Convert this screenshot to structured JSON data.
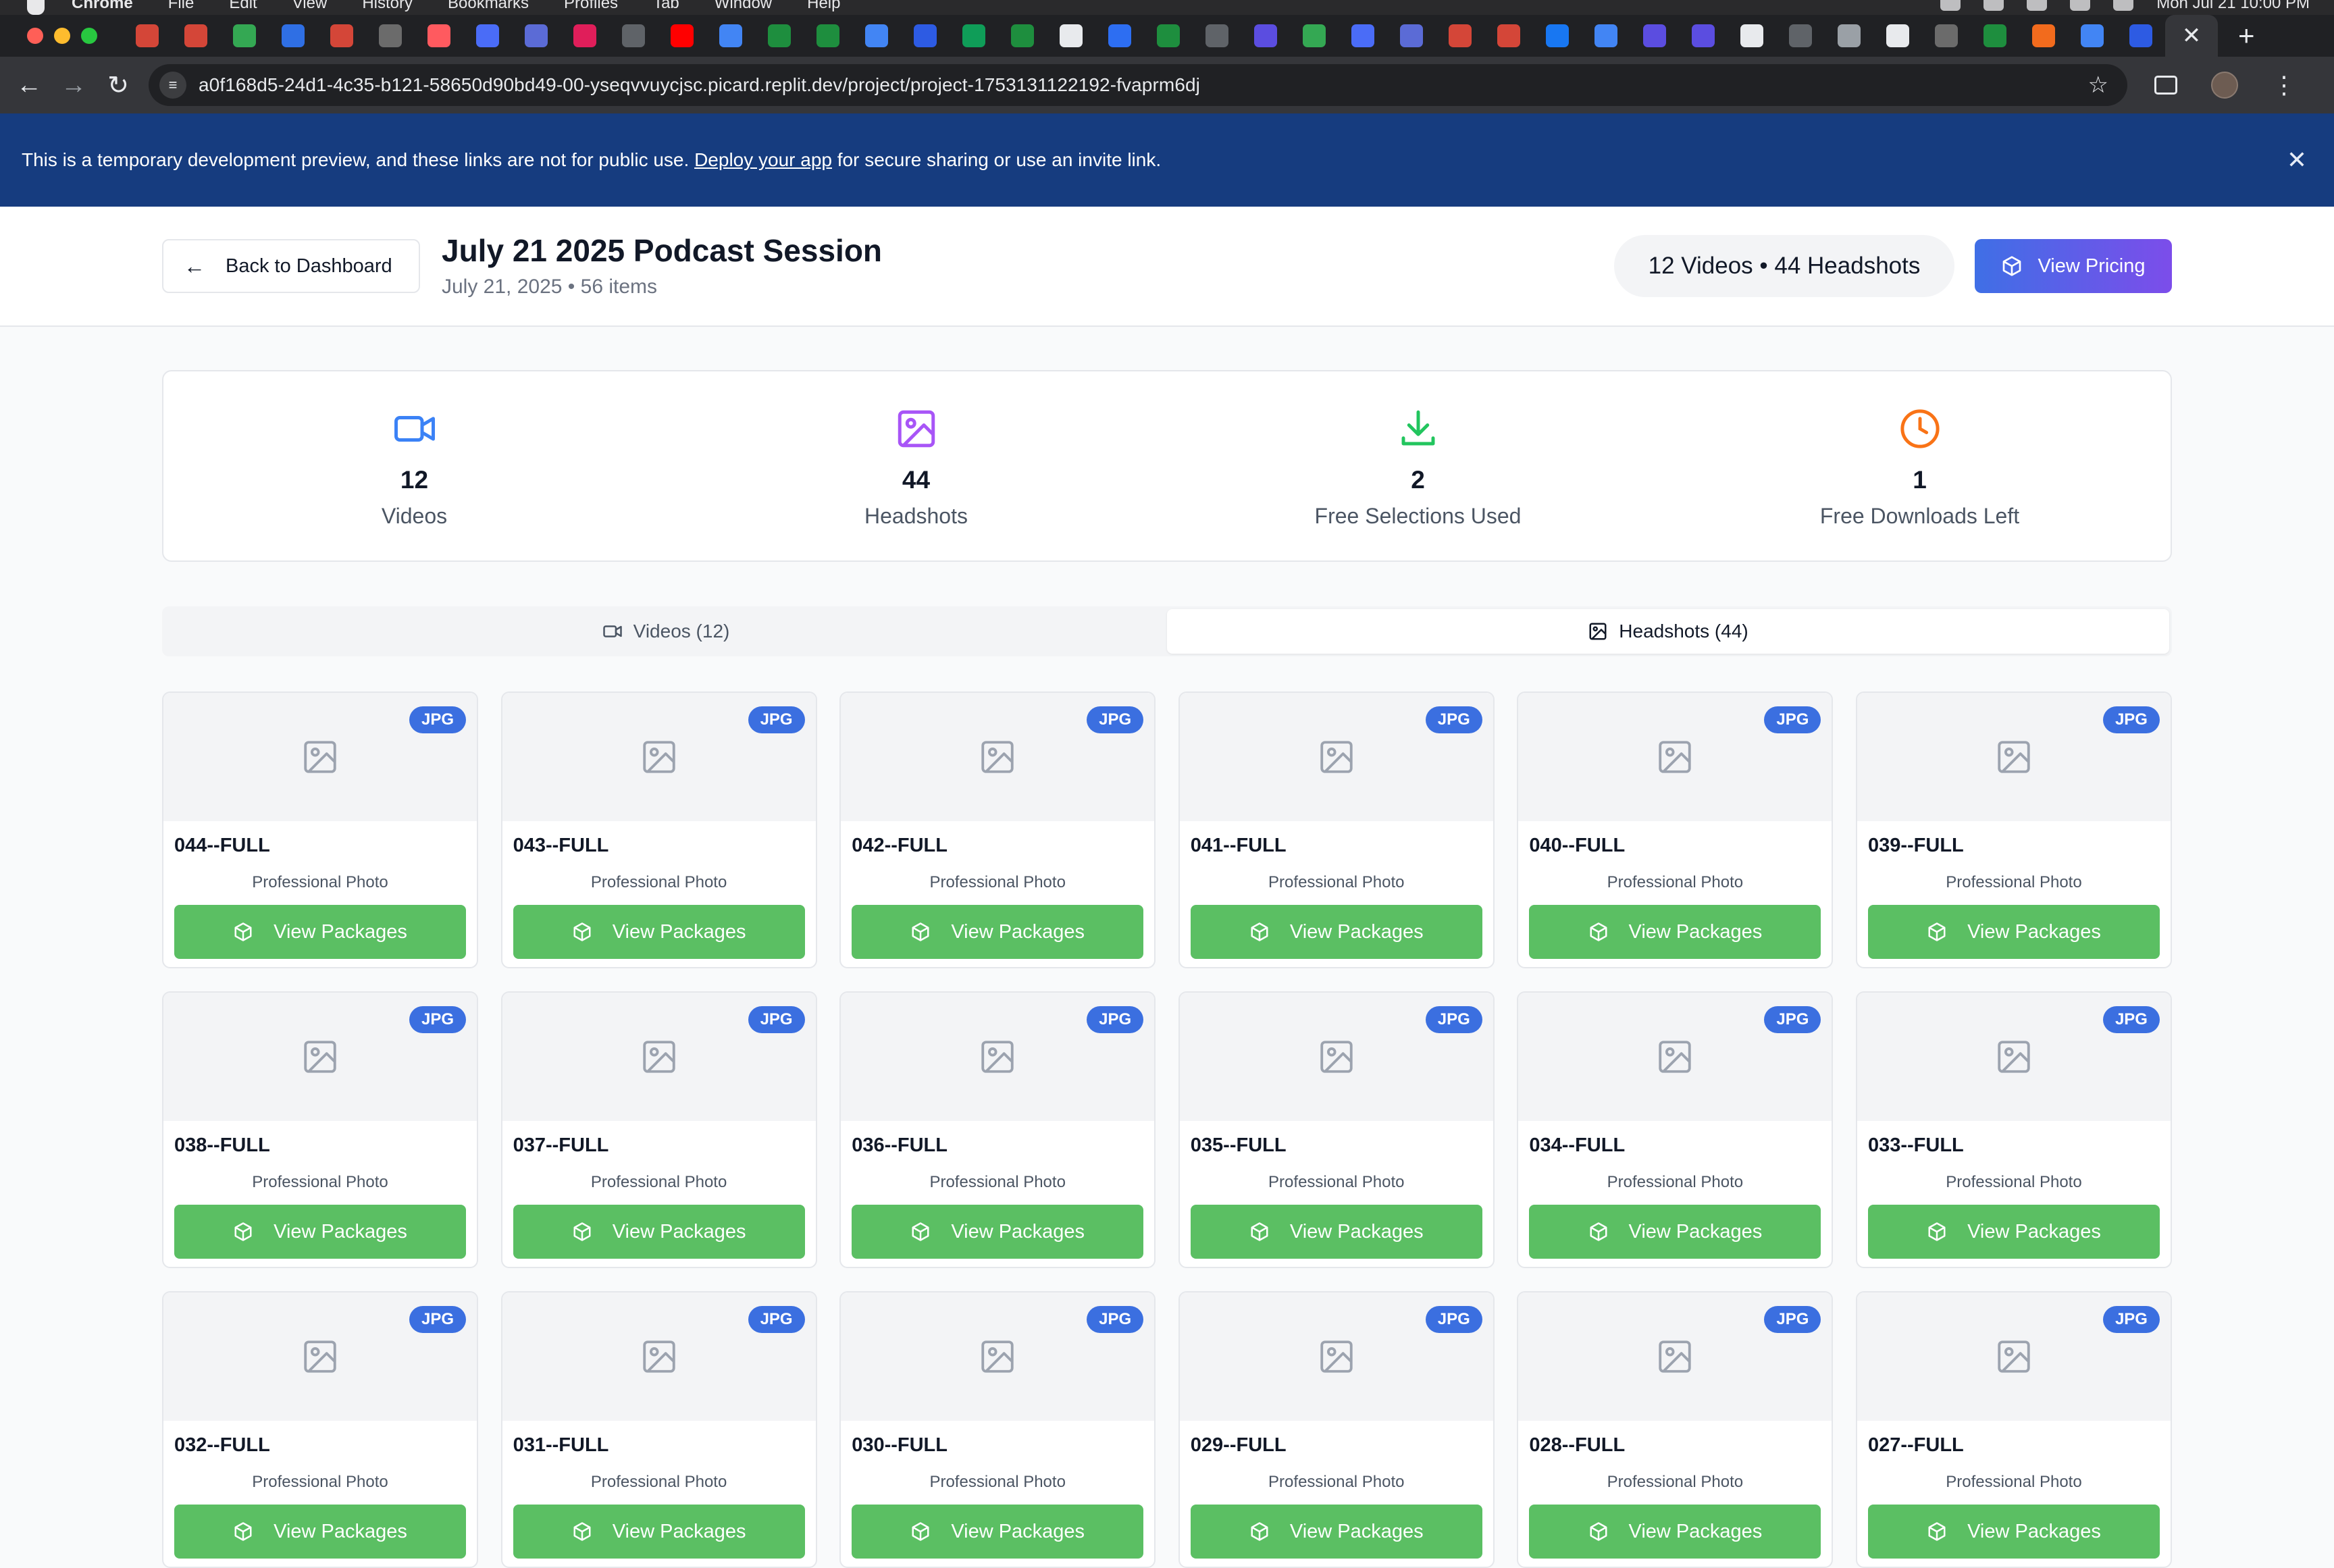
{
  "menubar": {
    "app": "Chrome",
    "items": [
      "File",
      "Edit",
      "View",
      "History",
      "Bookmarks",
      "Profiles",
      "Tab",
      "Window",
      "Help"
    ],
    "clock": "Mon Jul 21  10:00 PM"
  },
  "browser": {
    "favicons": [
      "#d44638",
      "#d44638",
      "#34a853",
      "#2f6fe4",
      "#d44638",
      "#6b6b6b",
      "#ff5a5f",
      "#4a6cf7",
      "#5b6bd6",
      "#e01e5a",
      "#5f6368",
      "#ff0000",
      "#4285f4",
      "#1e8e3e",
      "#1e8e3e",
      "#4285f4",
      "#2d5be3",
      "#0f9d58",
      "#1e8e3e",
      "#e8eaed",
      "#2d6ef2",
      "#1e8e3e",
      "#5f6368",
      "#5b4de0",
      "#34a853",
      "#4a6cf7",
      "#5b6bd6",
      "#d44638",
      "#d44638",
      "#1877f2",
      "#4285f4",
      "#5b4de0",
      "#5b4de0",
      "#e8eaed",
      "#5f6368",
      "#9aa0a6",
      "#e8eaed",
      "#6b6b6b",
      "#1e8e3e",
      "#f26b1d",
      "#4285f4",
      "#2d5be3"
    ],
    "url": "a0f168d5-24d1-4c35-b121-58650d90bd49-00-yseqvvuycjsc.picard.replit.dev/project/project-1753131122192-fvaprm6dj"
  },
  "banner": {
    "pre": "This is a temporary development preview, and these links are not for public use. ",
    "link": "Deploy your app",
    "post": " for secure sharing or use an invite link."
  },
  "header": {
    "back_label": "Back to Dashboard",
    "title": "July 21 2025 Podcast Session",
    "subtitle": "July 21, 2025 • 56 items",
    "counts": "12 Videos • 44 Headshots",
    "pricing_label": "View Pricing"
  },
  "stats": [
    {
      "value": "12",
      "label": "Videos",
      "color": "#3b82f6",
      "icon": "video-icon"
    },
    {
      "value": "44",
      "label": "Headshots",
      "color": "#a855f7",
      "icon": "image-icon"
    },
    {
      "value": "2",
      "label": "Free Selections Used",
      "color": "#22c55e",
      "icon": "download-icon"
    },
    {
      "value": "1",
      "label": "Free Downloads Left",
      "color": "#f97316",
      "icon": "clock-icon"
    }
  ],
  "tabs": {
    "videos": "Videos (12)",
    "headshots": "Headshots (44)",
    "active": "headshots"
  },
  "cards": [
    {
      "name": "044--FULL",
      "badge": "JPG",
      "type": "Professional Photo",
      "action": "View Packages"
    },
    {
      "name": "043--FULL",
      "badge": "JPG",
      "type": "Professional Photo",
      "action": "View Packages"
    },
    {
      "name": "042--FULL",
      "badge": "JPG",
      "type": "Professional Photo",
      "action": "View Packages"
    },
    {
      "name": "041--FULL",
      "badge": "JPG",
      "type": "Professional Photo",
      "action": "View Packages"
    },
    {
      "name": "040--FULL",
      "badge": "JPG",
      "type": "Professional Photo",
      "action": "View Packages"
    },
    {
      "name": "039--FULL",
      "badge": "JPG",
      "type": "Professional Photo",
      "action": "View Packages"
    },
    {
      "name": "038--FULL",
      "badge": "JPG",
      "type": "Professional Photo",
      "action": "View Packages"
    },
    {
      "name": "037--FULL",
      "badge": "JPG",
      "type": "Professional Photo",
      "action": "View Packages"
    },
    {
      "name": "036--FULL",
      "badge": "JPG",
      "type": "Professional Photo",
      "action": "View Packages"
    },
    {
      "name": "035--FULL",
      "badge": "JPG",
      "type": "Professional Photo",
      "action": "View Packages"
    },
    {
      "name": "034--FULL",
      "badge": "JPG",
      "type": "Professional Photo",
      "action": "View Packages"
    },
    {
      "name": "033--FULL",
      "badge": "JPG",
      "type": "Professional Photo",
      "action": "View Packages"
    },
    {
      "name": "032--FULL",
      "badge": "JPG",
      "type": "Professional Photo",
      "action": "View Packages"
    },
    {
      "name": "031--FULL",
      "badge": "JPG",
      "type": "Professional Photo",
      "action": "View Packages"
    },
    {
      "name": "030--FULL",
      "badge": "JPG",
      "type": "Professional Photo",
      "action": "View Packages"
    },
    {
      "name": "029--FULL",
      "badge": "JPG",
      "type": "Professional Photo",
      "action": "View Packages"
    },
    {
      "name": "028--FULL",
      "badge": "JPG",
      "type": "Professional Photo",
      "action": "View Packages"
    },
    {
      "name": "027--FULL",
      "badge": "JPG",
      "type": "Professional Photo",
      "action": "View Packages"
    }
  ]
}
